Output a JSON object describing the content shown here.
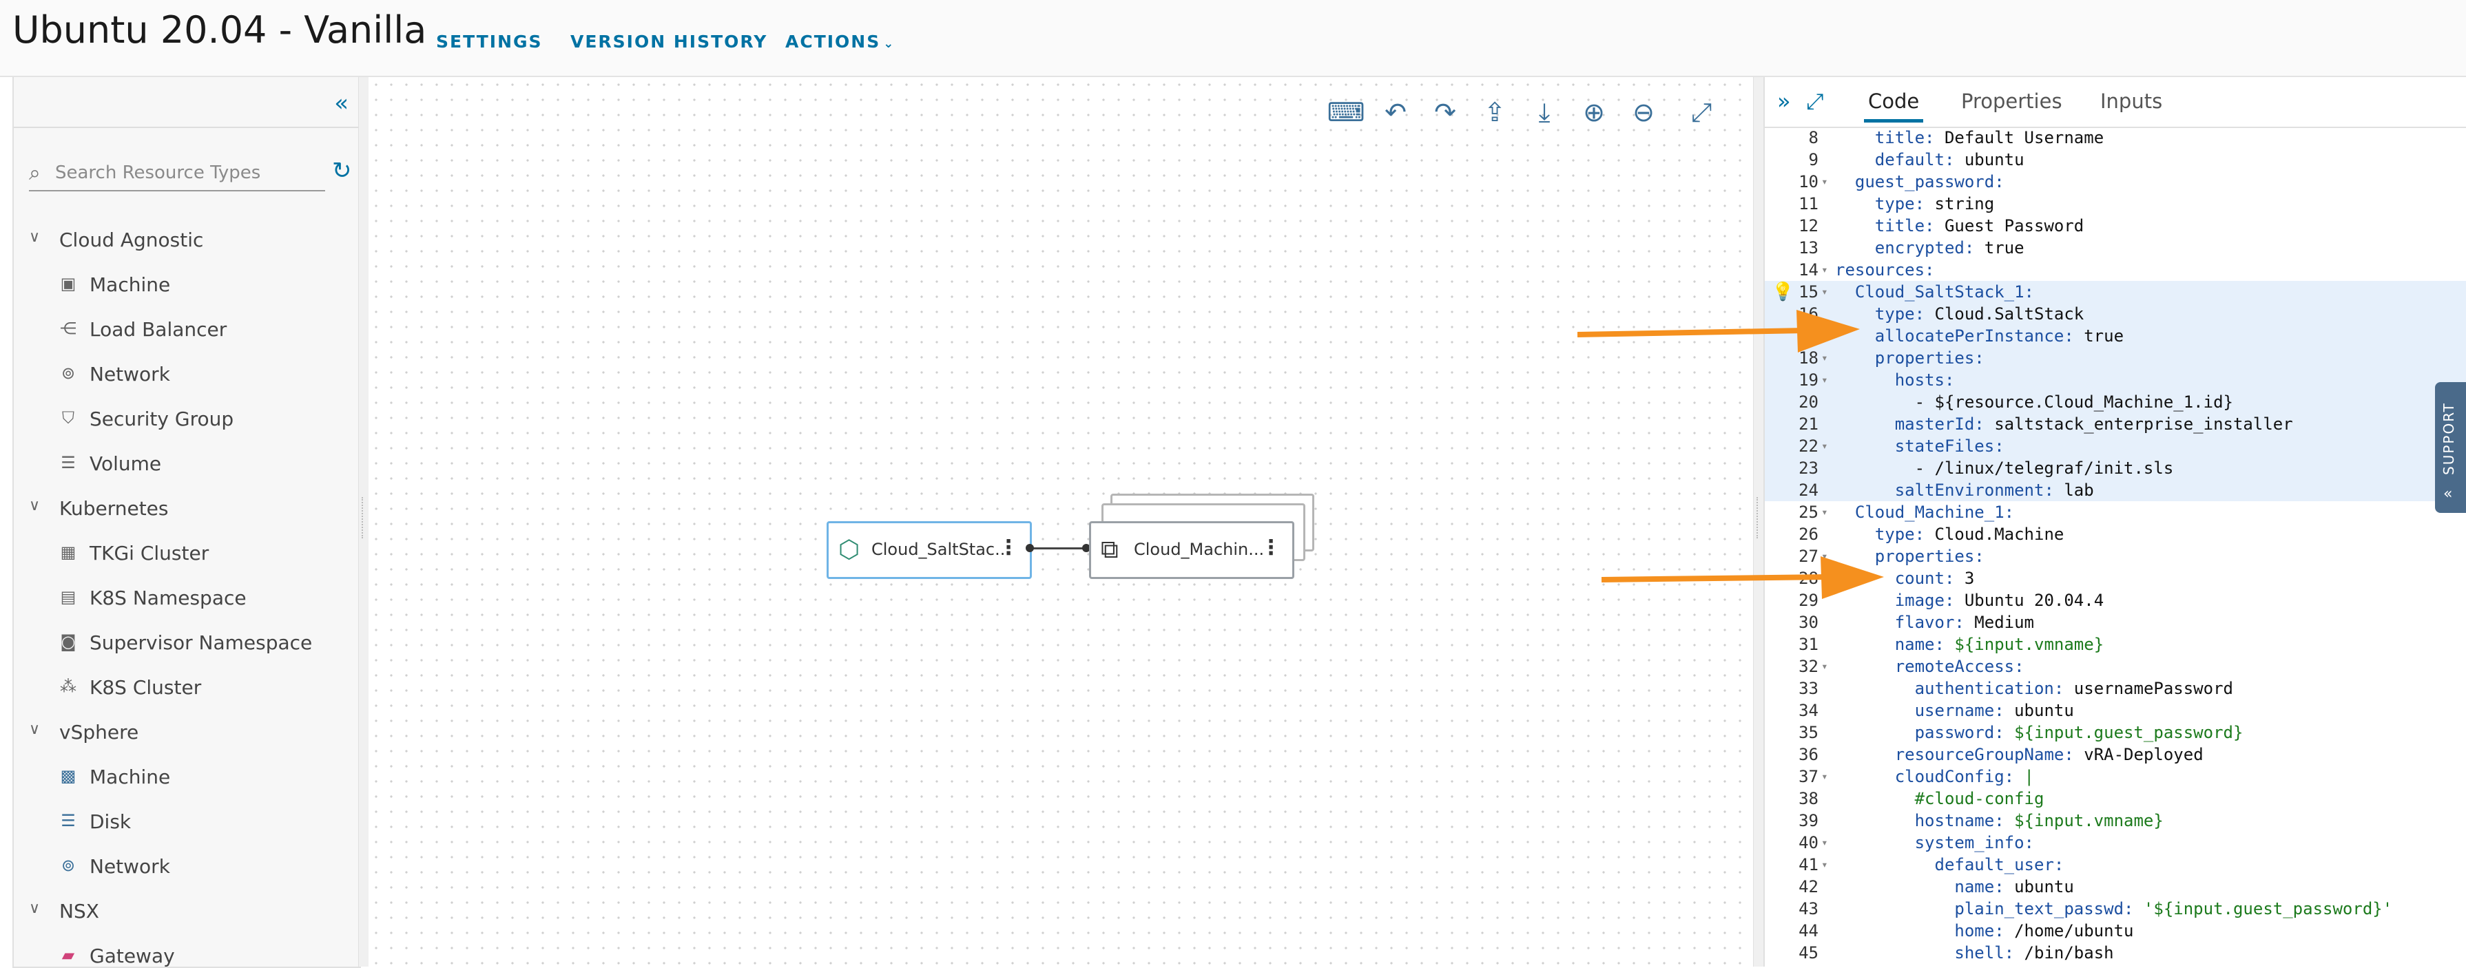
{
  "header": {
    "title": "Ubuntu 20.04 - Vanilla",
    "links": [
      "SETTINGS",
      "VERSION HISTORY",
      "ACTIONS"
    ]
  },
  "palette": {
    "search_placeholder": "Search Resource Types",
    "categories": [
      {
        "label": "Cloud Agnostic",
        "items": [
          {
            "label": "Machine",
            "icon": "machine-icon"
          },
          {
            "label": "Load Balancer",
            "icon": "load-balancer-icon"
          },
          {
            "label": "Network",
            "icon": "network-icon"
          },
          {
            "label": "Security Group",
            "icon": "shield-icon"
          },
          {
            "label": "Volume",
            "icon": "volume-icon"
          }
        ]
      },
      {
        "label": "Kubernetes",
        "items": [
          {
            "label": "TKGi Cluster",
            "icon": "cluster-icon"
          },
          {
            "label": "K8S Namespace",
            "icon": "namespace-icon"
          },
          {
            "label": "Supervisor Namespace",
            "icon": "supervisor-namespace-icon"
          },
          {
            "label": "K8S Cluster",
            "icon": "k8s-cluster-icon"
          }
        ]
      },
      {
        "label": "vSphere",
        "items": [
          {
            "label": "Machine",
            "icon": "vm-icon"
          },
          {
            "label": "Disk",
            "icon": "disk-icon"
          },
          {
            "label": "Network",
            "icon": "network-icon"
          }
        ]
      },
      {
        "label": "NSX",
        "items": [
          {
            "label": "Gateway",
            "icon": "gateway-icon"
          }
        ]
      }
    ]
  },
  "canvas": {
    "nodes": [
      {
        "label": "Cloud_SaltStac...",
        "icon": "saltstack-icon"
      },
      {
        "label": "Cloud_Machin...",
        "icon": "machine-stack-icon"
      }
    ]
  },
  "code_panel": {
    "tabs": [
      "Code",
      "Properties",
      "Inputs"
    ],
    "active_tab": "Code",
    "lines": [
      {
        "n": "8",
        "text": "    title: Default Username"
      },
      {
        "n": "9",
        "text": "    default: ubuntu"
      },
      {
        "n": "10",
        "text": "  guest_password:",
        "fold": true
      },
      {
        "n": "11",
        "text": "    type: string"
      },
      {
        "n": "12",
        "text": "    title: Guest Password"
      },
      {
        "n": "13",
        "text": "    encrypted: true"
      },
      {
        "n": "14",
        "text": "resources:",
        "fold": true
      },
      {
        "n": "15",
        "text": "  Cloud_SaltStack_1:",
        "fold": true,
        "hl": true,
        "bulb": true
      },
      {
        "n": "16",
        "text": "    type: Cloud.SaltStack",
        "hl": true
      },
      {
        "n": "17",
        "text": "    allocatePerInstance: true",
        "hl": true
      },
      {
        "n": "18",
        "text": "    properties:",
        "fold": true,
        "hl": true
      },
      {
        "n": "19",
        "text": "      hosts:",
        "fold": true,
        "hl": true
      },
      {
        "n": "20",
        "text": "        - ${resource.Cloud_Machine_1.id}",
        "hl": true
      },
      {
        "n": "21",
        "text": "      masterId: saltstack_enterprise_installer",
        "hl": true
      },
      {
        "n": "22",
        "text": "      stateFiles:",
        "fold": true,
        "hl": true
      },
      {
        "n": "23",
        "text": "        - /linux/telegraf/init.sls",
        "hl": true
      },
      {
        "n": "24",
        "text": "      saltEnvironment: lab",
        "hl": true
      },
      {
        "n": "25",
        "text": "  Cloud_Machine_1:",
        "fold": true
      },
      {
        "n": "26",
        "text": "    type: Cloud.Machine"
      },
      {
        "n": "27",
        "text": "    properties:",
        "fold": true
      },
      {
        "n": "28",
        "text": "      count: 3"
      },
      {
        "n": "29",
        "text": "      image: Ubuntu 20.04.4"
      },
      {
        "n": "30",
        "text": "      flavor: Medium"
      },
      {
        "n": "31",
        "text": "      name: ${input.vmname}"
      },
      {
        "n": "32",
        "text": "      remoteAccess:",
        "fold": true
      },
      {
        "n": "33",
        "text": "        authentication: usernamePassword"
      },
      {
        "n": "34",
        "text": "        username: ubuntu"
      },
      {
        "n": "35",
        "text": "        password: ${input.guest_password}"
      },
      {
        "n": "36",
        "text": "      resourceGroupName: vRA-Deployed"
      },
      {
        "n": "37",
        "text": "      cloudConfig: |",
        "fold": true
      },
      {
        "n": "38",
        "text": "        #cloud-config"
      },
      {
        "n": "39",
        "text": "        hostname: ${input.vmname}"
      },
      {
        "n": "40",
        "text": "        system_info:",
        "fold": true
      },
      {
        "n": "41",
        "text": "          default_user:",
        "fold": true
      },
      {
        "n": "42",
        "text": "            name: ubuntu"
      },
      {
        "n": "43",
        "text": "            plain_text_passwd: '${input.guest_password}'"
      },
      {
        "n": "44",
        "text": "            home: /home/ubuntu"
      },
      {
        "n": "45",
        "text": "            shell: /bin/bash"
      }
    ]
  },
  "support_tab": "SUPPORT",
  "colors": {
    "accent": "#0072a3",
    "highlight": "#e6f0fb",
    "arrow": "#f5901e"
  }
}
